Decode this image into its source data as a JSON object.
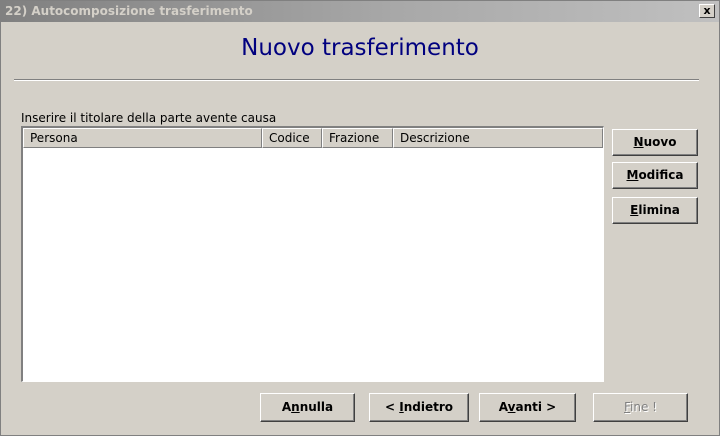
{
  "window": {
    "title": "22) Autocomposizione trasferimento",
    "close_label": "x"
  },
  "heading": "Nuovo trasferimento",
  "instruction": "Inserire il titolare della parte avente causa",
  "list": {
    "columns": [
      "Persona",
      "Codice",
      "Frazione",
      "Descrizione"
    ],
    "rows": []
  },
  "side_buttons": {
    "nuovo": {
      "mnemonic": "N",
      "rest": "uovo"
    },
    "modifica": {
      "mnemonic": "M",
      "rest": "odifica"
    },
    "elimina": {
      "mnemonic": "E",
      "rest": "limina"
    }
  },
  "bottom_buttons": {
    "annulla": {
      "pre": "A",
      "mnemonic": "n",
      "rest": "nulla"
    },
    "indietro": {
      "pre": "< ",
      "mnemonic": "I",
      "rest": "ndietro"
    },
    "avanti": {
      "pre": "A",
      "mnemonic": "v",
      "rest": "anti >"
    },
    "fine": {
      "pre": "",
      "mnemonic": "F",
      "rest": "ine !"
    }
  },
  "colors": {
    "heading": "#00007f",
    "dialog_background": "#d4d0c8",
    "titlebar_inactive_start": "#808080",
    "titlebar_inactive_end": "#c0c0c0"
  }
}
